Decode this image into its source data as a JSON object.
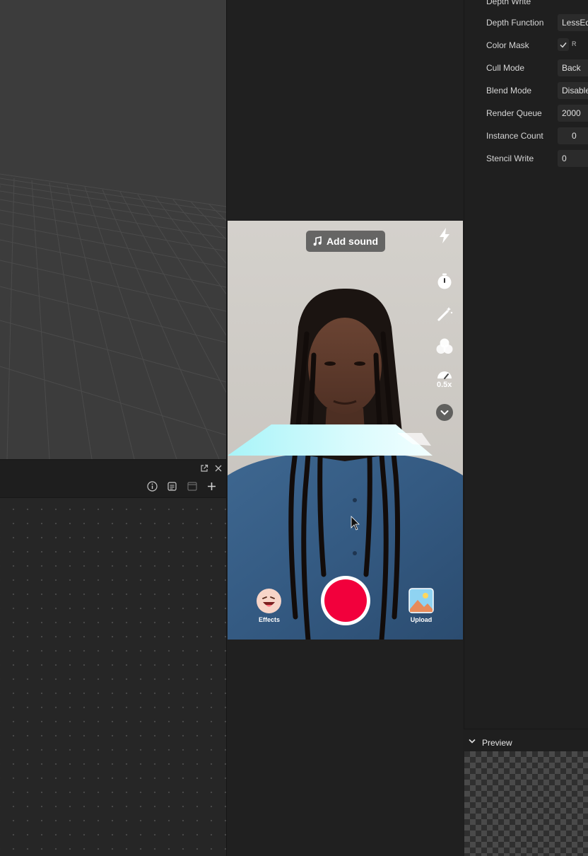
{
  "inspector": {
    "top_partial_label": "Depth Write",
    "properties": [
      {
        "label": "Depth Function",
        "value": "LessEqu"
      },
      {
        "label": "Color Mask",
        "value": "R"
      },
      {
        "label": "Cull Mode",
        "value": "Back"
      },
      {
        "label": "Blend Mode",
        "value": "Disable"
      },
      {
        "label": "Render Queue",
        "value": "2000"
      },
      {
        "label": "Instance Count",
        "value": "0"
      },
      {
        "label": "Stencil Write",
        "value": "0"
      }
    ]
  },
  "phone": {
    "add_sound_label": "Add sound",
    "speed_label": "0.5x",
    "effects_label": "Effects",
    "upload_label": "Upload",
    "record_color": "#f2003c"
  },
  "preview": {
    "title": "Preview"
  },
  "colors": {
    "viewport_bg": "#3c3c3c",
    "panel_bg": "#1f1f1f",
    "accent": "#f2003c"
  }
}
